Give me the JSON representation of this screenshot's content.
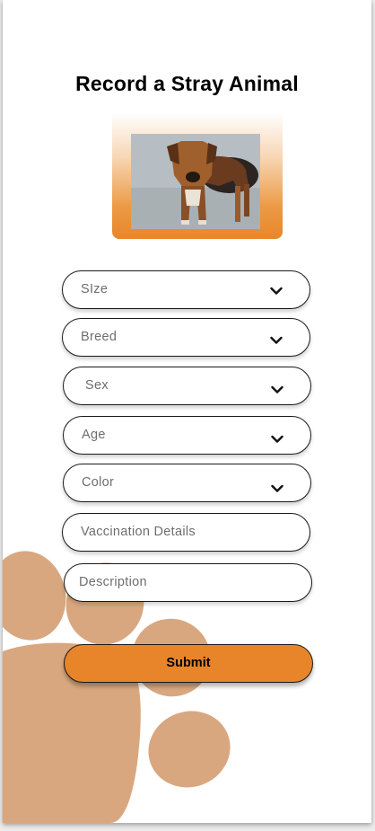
{
  "page": {
    "title": "Record a Stray Animal"
  },
  "photo": {
    "subject": "dog-photo"
  },
  "form": {
    "fields": [
      {
        "label": "SIze",
        "type": "dropdown"
      },
      {
        "label": "Breed",
        "type": "dropdown"
      },
      {
        "label": "Sex",
        "type": "dropdown"
      },
      {
        "label": "Age",
        "type": "dropdown"
      },
      {
        "label": "Color",
        "type": "dropdown"
      },
      {
        "label": "Vaccination Details",
        "type": "text"
      },
      {
        "label": "Description",
        "type": "text"
      }
    ],
    "submit_label": "Submit"
  },
  "colors": {
    "accent": "#e8852a",
    "paw": "#d9a77f",
    "border": "#1a1a1a",
    "placeholder": "#6e6e6e"
  },
  "icons": {
    "dropdown": "chevron-down-icon",
    "decoration": "paw-print-icon"
  }
}
